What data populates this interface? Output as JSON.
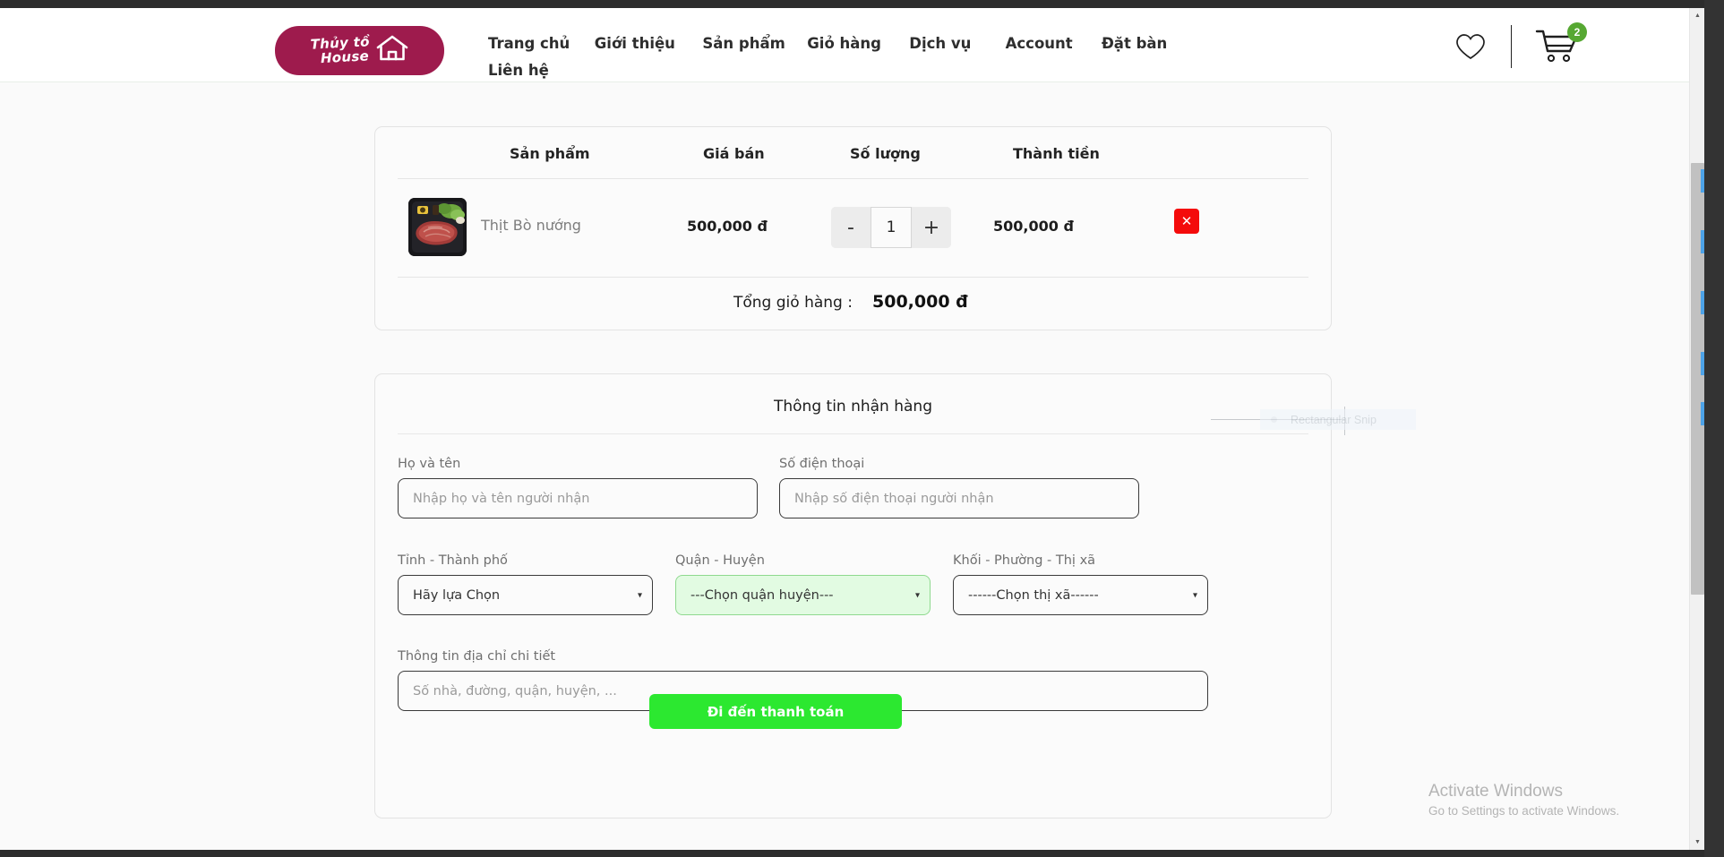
{
  "site": {
    "logo": {
      "line1": "Thủy tồ",
      "line2": "House",
      "icon": "house-icon",
      "color": "#9e1b4d"
    },
    "nav": {
      "row1": [
        {
          "label": "Trang chủ"
        },
        {
          "label": "Giới thiệu"
        },
        {
          "label": "Sản phẩm"
        },
        {
          "label": "Giỏ hàng"
        },
        {
          "label": "Dịch vụ"
        },
        {
          "label": "Account"
        },
        {
          "label": "Đặt bàn"
        }
      ],
      "row2": [
        {
          "label": "Liên hệ"
        }
      ]
    },
    "header_icons": {
      "wishlist": "heart-icon",
      "cart": "shopping-cart-icon",
      "cart_count": "2",
      "badge_color": "#56a832"
    }
  },
  "cart": {
    "columns": [
      "Sản phẩm",
      "Giá bán",
      "Số lượng",
      "Thành tiền"
    ],
    "items": [
      {
        "name": "Thịt Bò nướng",
        "price": "500,000 đ",
        "quantity": "1",
        "total": "500,000 đ",
        "decrease_label": "-",
        "increase_label": "+",
        "remove_label": "✕"
      }
    ],
    "total_label": "Tổng giỏ hàng :",
    "total_value": "500,000 đ"
  },
  "shipping_form": {
    "title": "Thông tin nhận hàng",
    "fields": {
      "fullname": {
        "label": "Họ và tên",
        "placeholder": "Nhập họ và tên người nhận",
        "value": ""
      },
      "phone": {
        "label": "Số điện thoại",
        "placeholder": "Nhập số điện thoại người nhận",
        "value": ""
      },
      "province": {
        "label": "Tỉnh - Thành phố",
        "selected": "Hãy lựa Chọn"
      },
      "district": {
        "label": "Quận - Huyện",
        "selected": "---Chọn quận huyện---",
        "highlight_color": "#e2fbe2"
      },
      "ward": {
        "label": "Khối - Phường - Thị xã",
        "selected": "------Chọn thị xã------"
      },
      "address": {
        "label": "Thông tin địa chỉ chi tiết",
        "placeholder": "Số nhà, đường, quận, huyện, ...",
        "value": ""
      }
    },
    "submit_label": "Đi đến thanh toán",
    "submit_color": "#2ce830"
  },
  "overlays": {
    "snip_tool_label": "Rectangular Snip",
    "watermark_title": "Activate Windows",
    "watermark_subtitle": "Go to Settings to activate Windows."
  }
}
